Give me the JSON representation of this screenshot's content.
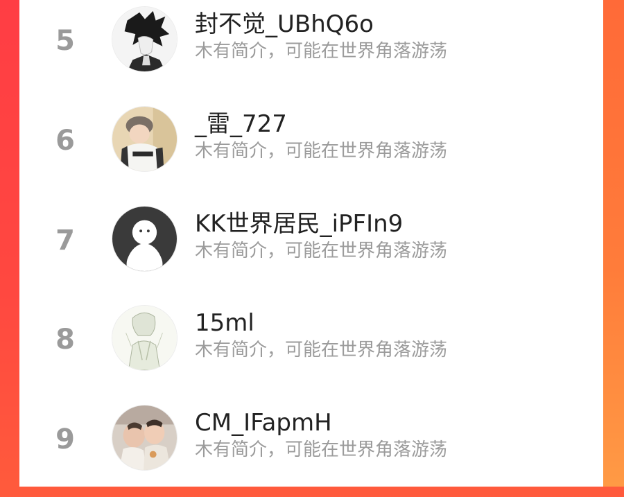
{
  "accent_colors": {
    "left_edge": "#ff3d44",
    "right_edge": "#ff8a3f",
    "rank_text": "#9a9a9a",
    "name_text": "#222222",
    "bio_text": "#9b9b9b"
  },
  "users": [
    {
      "rank": "5",
      "name": "封不觉_UBhQ6o",
      "bio": "木有简介，可能在世界角落游荡",
      "avatar_icon": "anime-boy-avatar"
    },
    {
      "rank": "6",
      "name": "_雷_727",
      "bio": "木有简介，可能在世界角落游荡",
      "avatar_icon": "child-beanie-avatar"
    },
    {
      "rank": "7",
      "name": "KK世界居民_iPFIn9",
      "bio": "木有简介，可能在世界角落游荡",
      "avatar_icon": "default-ghost-avatar"
    },
    {
      "rank": "8",
      "name": "15ml",
      "bio": "木有简介，可能在世界角落游荡",
      "avatar_icon": "sketch-character-avatar"
    },
    {
      "rank": "9",
      "name": "CM_IFapmH",
      "bio": "木有简介，可能在世界角落游荡",
      "avatar_icon": "babies-photo-avatar"
    }
  ]
}
